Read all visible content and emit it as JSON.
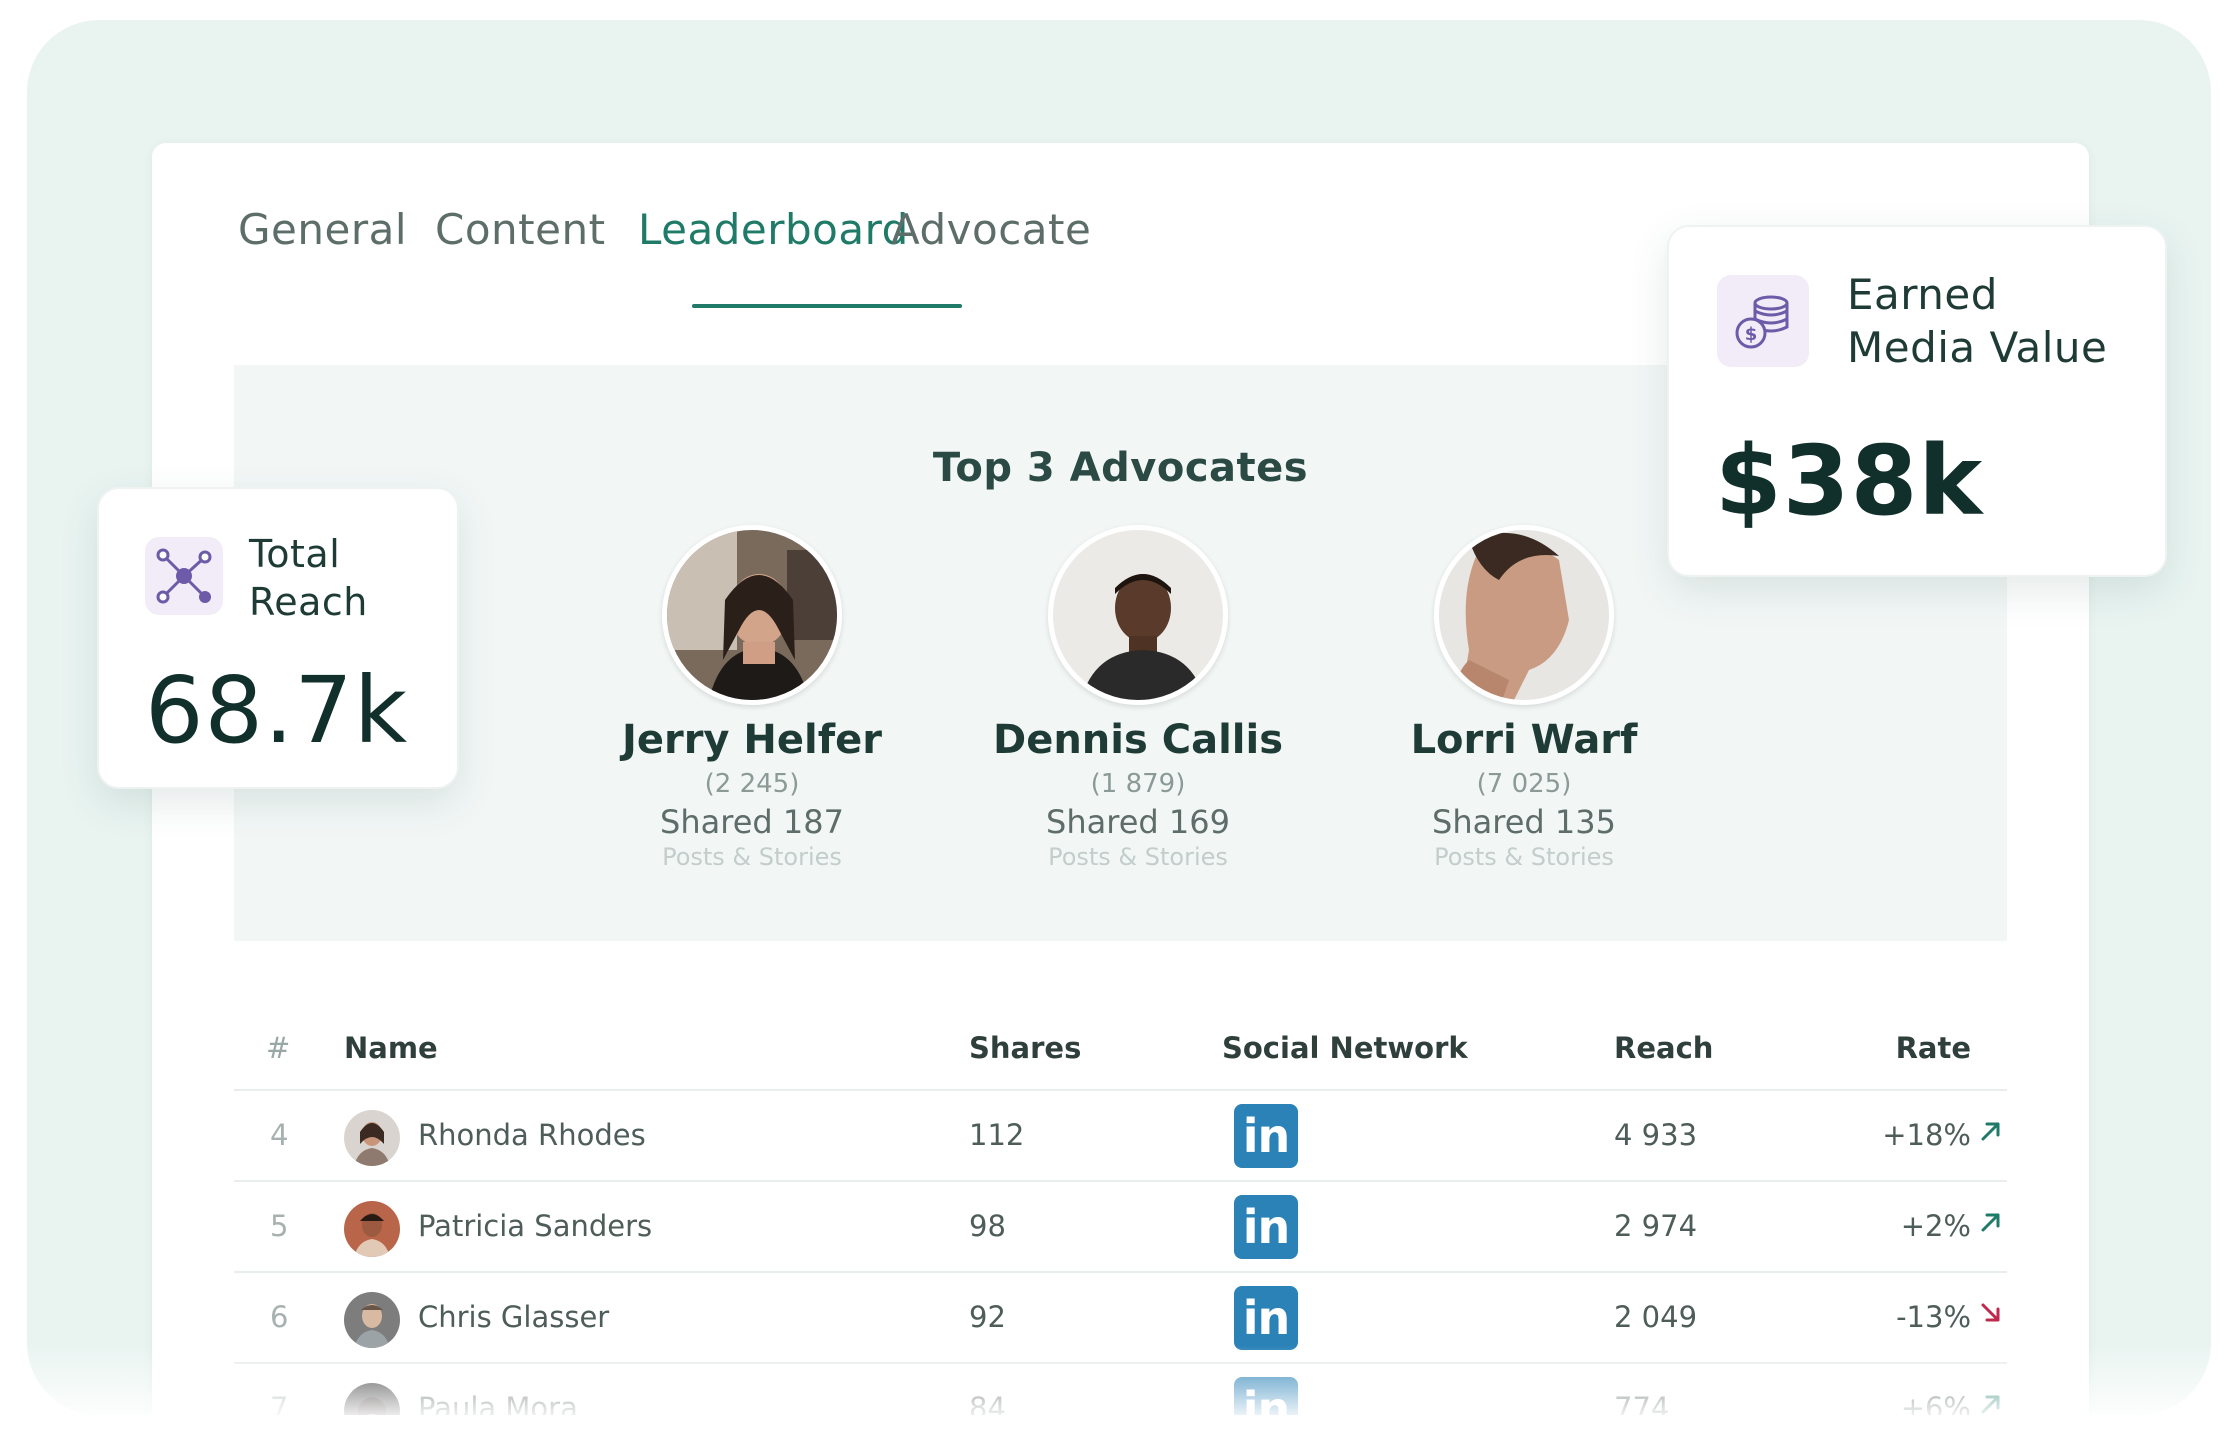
{
  "tabs": [
    {
      "label": "General",
      "active": false
    },
    {
      "label": "Content",
      "active": false
    },
    {
      "label": "Leaderboard",
      "active": true
    },
    {
      "label": "Advocate",
      "active": false
    }
  ],
  "top_advocates": {
    "title": "Top 3 Advocates",
    "people": [
      {
        "name": "Jerry Helfer",
        "count": "(2 245)",
        "shared": "Shared 187",
        "subtitle": "Posts & Stories"
      },
      {
        "name": "Dennis Callis",
        "count": "(1 879)",
        "shared": "Shared 169",
        "subtitle": "Posts & Stories"
      },
      {
        "name": "Lorri Warf",
        "count": "(7 025)",
        "shared": "Shared 135",
        "subtitle": "Posts & Stories"
      }
    ]
  },
  "table": {
    "headers": {
      "rank": "#",
      "name": "Name",
      "shares": "Shares",
      "network": "Social Network",
      "reach": "Reach",
      "rate": "Rate"
    },
    "rows": [
      {
        "rank": "4",
        "name": "Rhonda Rhodes",
        "shares": "112",
        "network": "in",
        "reach": "4 933",
        "rate": "+18%",
        "trend": "up"
      },
      {
        "rank": "5",
        "name": "Patricia Sanders",
        "shares": "98",
        "network": "in",
        "reach": "2 974",
        "rate": "+2%",
        "trend": "up"
      },
      {
        "rank": "6",
        "name": "Chris Glasser",
        "shares": "92",
        "network": "in",
        "reach": "2 049",
        "rate": "-13%",
        "trend": "down"
      },
      {
        "rank": "7",
        "name": "Paula Mora",
        "shares": "84",
        "network": "in",
        "reach": "774",
        "rate": "+6%",
        "trend": "up"
      }
    ]
  },
  "total_reach": {
    "label_line1": "Total",
    "label_line2": "Reach",
    "value": "68.7k",
    "icon": "network-nodes-icon"
  },
  "earned_media": {
    "label_line1": "Earned",
    "label_line2": "Media Value",
    "value": "$38k",
    "icon": "coins-dollar-icon"
  },
  "colors": {
    "accent": "#1f7a67",
    "linkedin": "#2a82b7",
    "trend_down": "#c0284d",
    "background": "#e9f4f1"
  }
}
